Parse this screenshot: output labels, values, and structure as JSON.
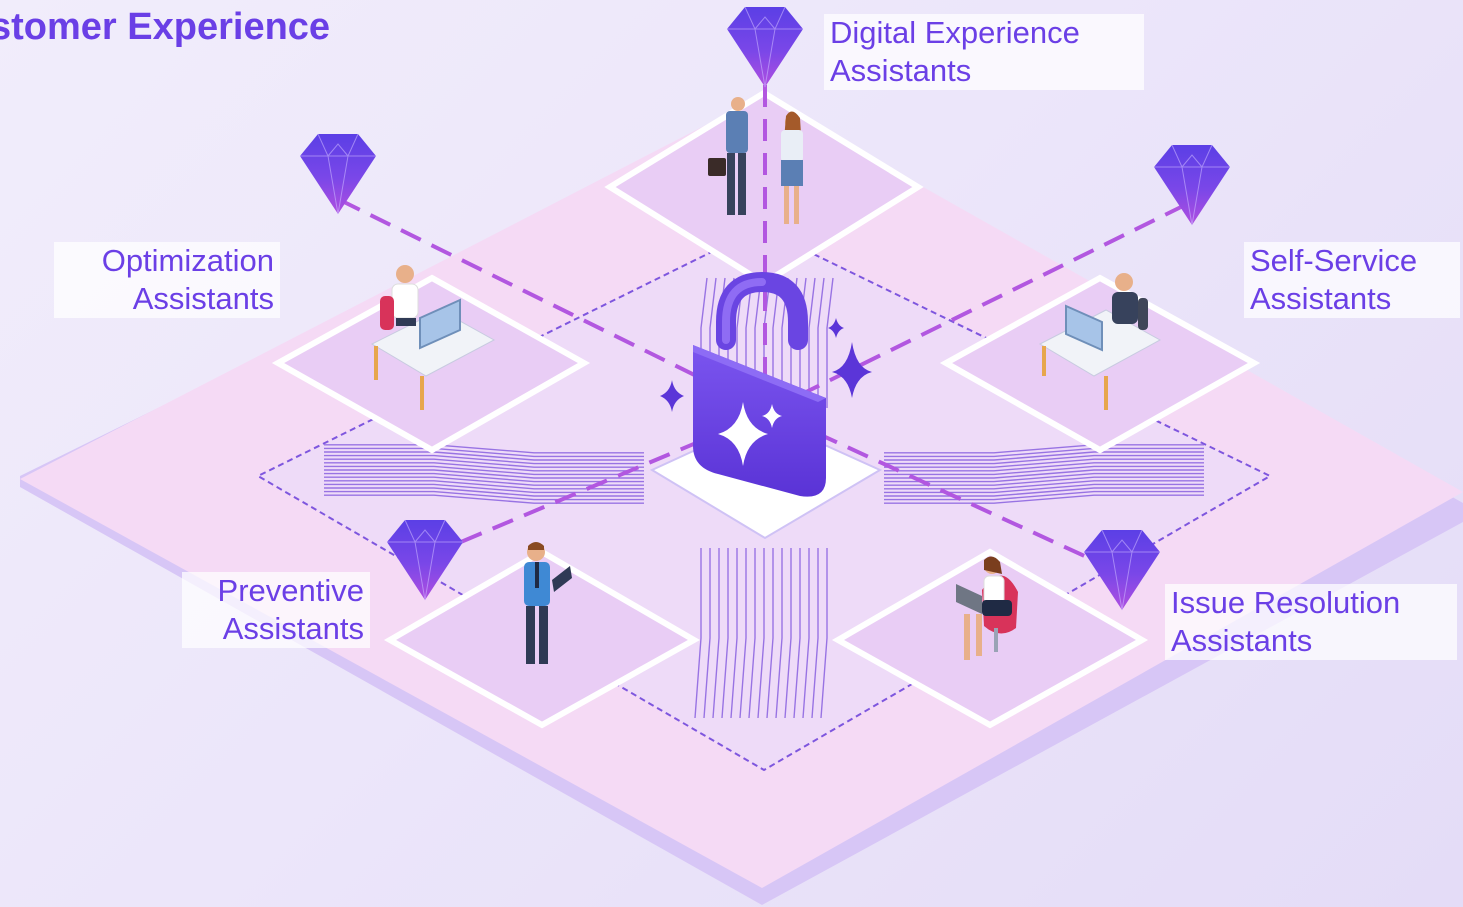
{
  "title": "stomer Experience",
  "center": {
    "icon": "padlock-sparkle-icon"
  },
  "colors": {
    "accent": "#6b3fe6",
    "platform": "#f6d8f5",
    "gem": "#7a4ae8",
    "dash": "#b257e0",
    "circuit": "#7e56de"
  },
  "nodes": [
    {
      "id": "digital",
      "line1": "Digital Experience",
      "line2": "Assistants",
      "scene": "two-people-handshake"
    },
    {
      "id": "optimization",
      "line1": "Optimization",
      "line2": "Assistants",
      "scene": "person-at-desk"
    },
    {
      "id": "selfservice",
      "line1": "Self-Service",
      "line2": "Assistants",
      "scene": "person-at-desk"
    },
    {
      "id": "preventive",
      "line1": "Preventive",
      "line2": "Assistants",
      "scene": "person-with-tablet"
    },
    {
      "id": "issue",
      "line1": "Issue Resolution",
      "line2": "Assistants",
      "scene": "person-with-laptop"
    }
  ]
}
